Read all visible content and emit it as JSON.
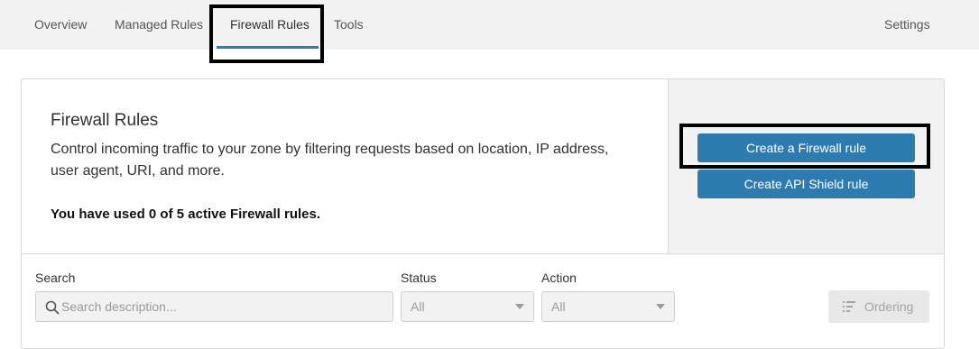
{
  "nav": {
    "tabs": [
      {
        "label": "Overview"
      },
      {
        "label": "Managed Rules"
      },
      {
        "label": "Firewall Rules",
        "active": true
      },
      {
        "label": "Tools"
      }
    ],
    "settings_label": "Settings"
  },
  "panel": {
    "title": "Firewall Rules",
    "description": "Control incoming traffic to your zone by filtering requests based on location, IP address, user agent, URI, and more.",
    "usage_text": "You have used 0 of 5 active Firewall rules.",
    "create_firewall_button": "Create a Firewall rule",
    "create_api_shield_button": "Create API Shield rule"
  },
  "filters": {
    "search_label": "Search",
    "search_placeholder": "Search description...",
    "status_label": "Status",
    "status_value": "All",
    "action_label": "Action",
    "action_value": "All",
    "ordering_label": "Ordering"
  },
  "colors": {
    "accent": "#2c7cb0",
    "nav_background": "#f2f2f2",
    "side_panel_background": "#f2f2f2"
  },
  "icons": {
    "search": "search-icon",
    "caret": "chevron-down-icon",
    "ordering": "list-order-icon"
  }
}
